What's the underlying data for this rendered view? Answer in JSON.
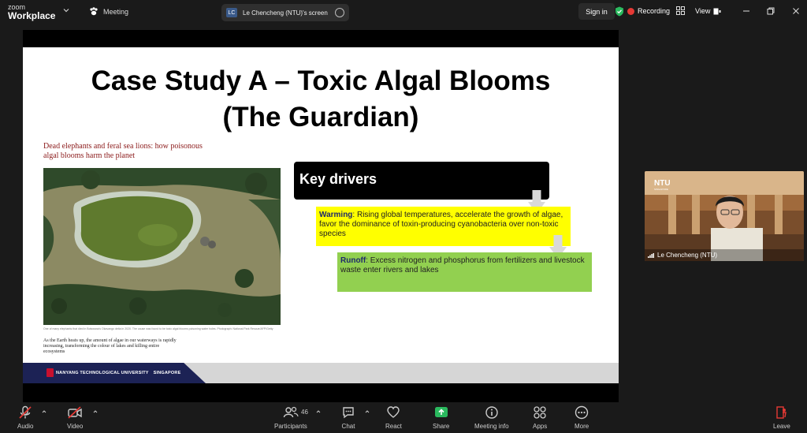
{
  "topbar": {
    "brand_line1": "zoom",
    "brand_line2": "Workplace",
    "meeting_label": "Meeting",
    "tab_initials": "LC",
    "tab_title": "Le Chencheng (NTU)'s screen",
    "signin_label": "Sign in",
    "recording_label": "Recording",
    "view_label": "View"
  },
  "slide": {
    "title_line1": "Case Study A – Toxic Algal Blooms",
    "title_line2": "(The Guardian)",
    "headline": "Dead elephants and feral sea lions: how poisonous algal blooms harm the planet",
    "photo_caption": "One of many elephants that died in Botswana's Okavango delta in 2020. The cause was found to be toxic algal blooms poisoning water holes. Photograph: National Park Rescue/AFP/Getty",
    "sub_caption": "As the Earth heats up, the amount of algae in our waterways is rapidly increasing, transforming the colour of lakes and killing entire ecosystems",
    "key_drivers": "Key drivers",
    "warming_label": "Warming",
    "warming_text": ": Rising global temperatures, accelerate the growth of algae, favor the dominance of toxin-producing cyanobacteria over non-toxic species",
    "runoff_label": "Runoff",
    "runoff_text": ": Excess nitrogen and phosphorus from fertilizers and livestock waste enter rivers and lakes",
    "footer_university": "NANYANG TECHNOLOGICAL UNIVERSITY",
    "footer_country": "SINGAPORE"
  },
  "participant": {
    "name": "Le Chencheng (NTU)",
    "background_logo": "NTU",
    "background_logo_sub": "SINGAPORE"
  },
  "toolbar": {
    "audio": "Audio",
    "video": "Video",
    "participants": "Participants",
    "participant_count": "46",
    "chat": "Chat",
    "react": "React",
    "share": "Share",
    "meeting_info": "Meeting info",
    "apps": "Apps",
    "more": "More",
    "leave": "Leave"
  },
  "colors": {
    "accent_green": "#2ab95e",
    "record_red": "#e53935",
    "warming_box": "#ffff00",
    "runoff_box": "#92d050"
  }
}
